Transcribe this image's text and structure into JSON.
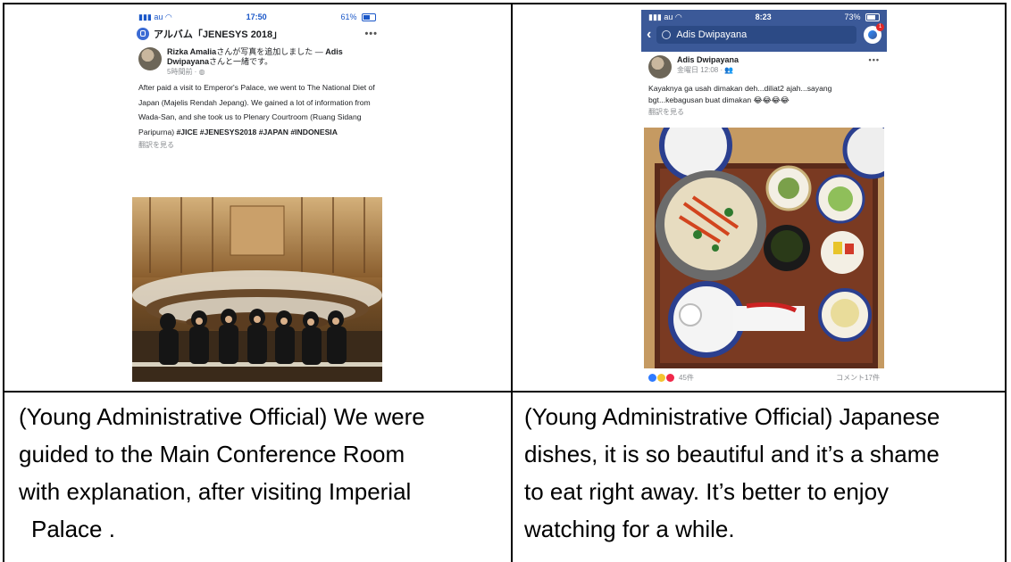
{
  "left_post": {
    "status": {
      "time": "17:50",
      "carrier": "au",
      "battery": "61%"
    },
    "album_title": "アルバム「JENESYS 2018」",
    "menu_dots": "•••",
    "author_line": "Rizka Amaliaさんが写真を追加しました — Adis Dwipayanaさんと一緒です。",
    "author_name": "Rizka Amalia",
    "author_rest": "さんが写真を追加しました — ",
    "tagged_name": "Adis Dwipayana",
    "tagged_rest": "さんと一緒です。",
    "timestamp": "5時間前 · ",
    "body": "After paid a visit to Emperor's Palace, we went to The National Diet of Japan (Majelis Rendah Jepang). We gained a lot of information from Wada-San, and she took us to Plenary Courtroom (Ruang Sidang Paripurna) ",
    "hashtags": "#JICE #JENESYS2018 #JAPAN #INDONESIA",
    "translate": "翻訳を見る"
  },
  "right_post": {
    "status": {
      "time": "8:23",
      "carrier": "au",
      "battery": "73%"
    },
    "search_query": "Adis Dwipayana",
    "messenger_badge": "1",
    "author": "Adis Dwipayana",
    "timestamp": "金曜日 12:08 · ",
    "body": "Kayaknya ga usah dimakan deh...diliat2 ajah...sayang bgt...kebagusan buat dimakan 😂😂😂😂",
    "translate": "翻訳を見る",
    "reactions_count": "45件",
    "comments_count": "コメント17件"
  },
  "captions": {
    "left": [
      "(Young Administrative Official) We were",
      "guided to the Main Conference Room",
      "with explanation, after visiting Imperial",
      "Palace ."
    ],
    "right": [
      "(Young Administrative Official) Japanese",
      "dishes, it is so beautiful and it’s a shame",
      "to eat right away. It’s better to enjoy",
      "watching for a while."
    ]
  },
  "colors": {
    "facebook_blue": "#3b5998",
    "status_blue": "#1a57c8"
  }
}
